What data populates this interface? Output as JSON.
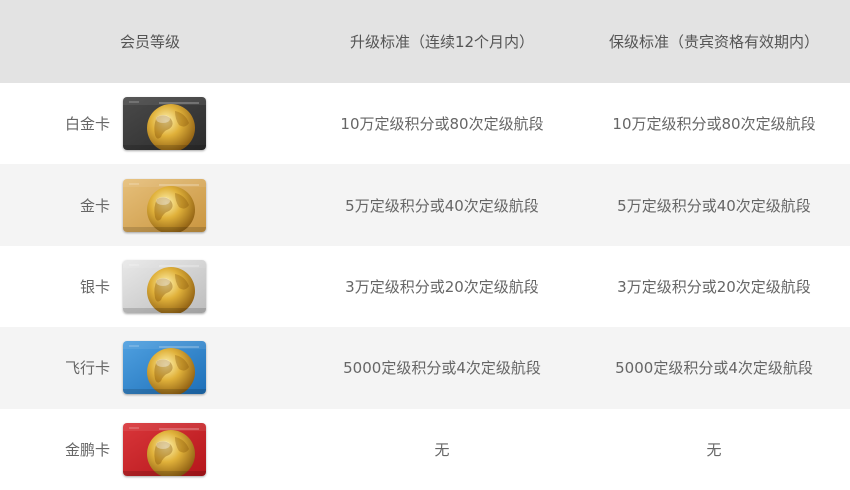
{
  "header": {
    "tier": "会员等级",
    "upgrade": "升级标准（连续12个月内）",
    "retain": "保级标准（贵宾资格有效期内）"
  },
  "rows": [
    {
      "tier": "白金卡",
      "card_color": "#2b2b2b",
      "card_color2": "#4a4a4a",
      "upgrade": "10万定级积分或80次定级航段",
      "retain": "10万定级积分或80次定级航段"
    },
    {
      "tier": "金卡",
      "card_color": "#c9953f",
      "card_color2": "#e6bf7a",
      "upgrade": "5万定级积分或40次定级航段",
      "retain": "5万定级积分或40次定级航段"
    },
    {
      "tier": "银卡",
      "card_color": "#bdbdbd",
      "card_color2": "#e8e8e8",
      "upgrade": "3万定级积分或20次定级航段",
      "retain": "3万定级积分或20次定级航段"
    },
    {
      "tier": "飞行卡",
      "card_color": "#1d6fb8",
      "card_color2": "#4fa0e0",
      "upgrade": "5000定级积分或4次定级航段",
      "retain": "5000定级积分或4次定级航段"
    },
    {
      "tier": "金鹏卡",
      "card_color": "#b5161b",
      "card_color2": "#d9363a",
      "upgrade": "无",
      "retain": "无"
    }
  ]
}
